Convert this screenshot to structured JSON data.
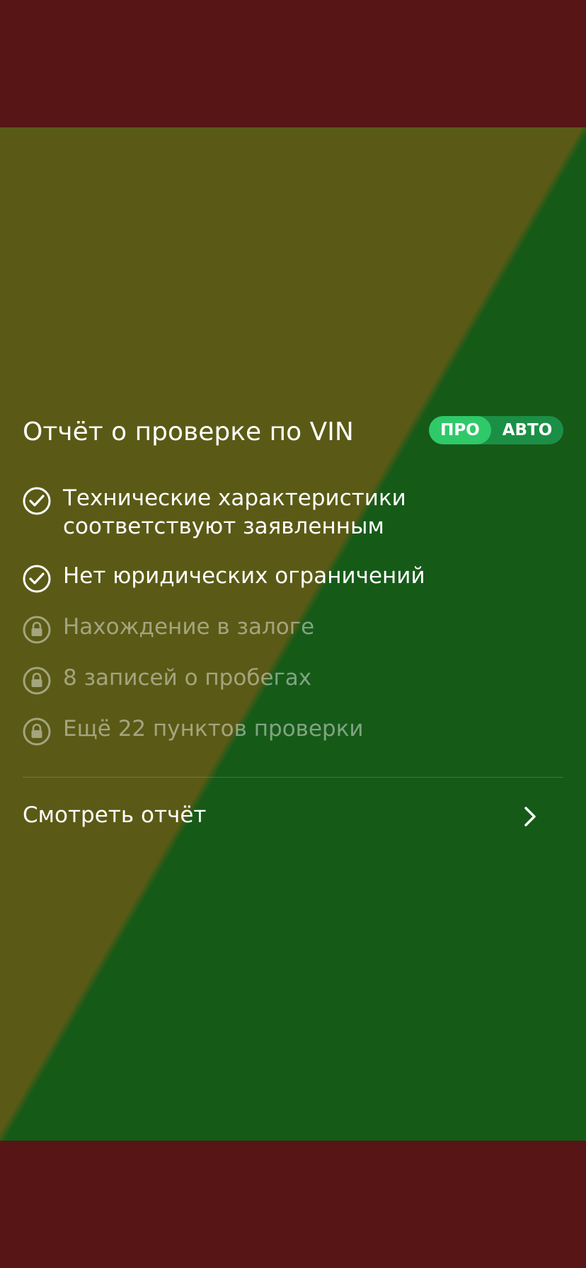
{
  "card": {
    "title": "Отчёт о проверке по VIN",
    "badge": {
      "left": "ПРО",
      "right": "АВТО"
    },
    "checklist": [
      {
        "label_line1": "Технические характеристики",
        "label_line2": "соответствуют заявленным",
        "status": "checked",
        "icon": "check-circle-icon"
      },
      {
        "label": "Нет юридических ограничений",
        "status": "checked",
        "icon": "check-circle-icon"
      },
      {
        "label": "Нахождение в залоге",
        "status": "locked",
        "icon": "lock-icon"
      },
      {
        "label": "8 записей о пробегах",
        "status": "locked",
        "icon": "lock-icon"
      },
      {
        "label": "Ещё 22 пунктов проверки",
        "status": "locked",
        "icon": "lock-icon"
      }
    ],
    "cta": {
      "label": "Смотреть отчёт",
      "icon": "chevron-right-icon"
    }
  },
  "colors": {
    "outer_band": "#571516",
    "card_top_left": "#5a5a16",
    "card_bottom_right": "#165a18",
    "badge_left": "#2fc96a",
    "badge_right": "#1c8f46"
  }
}
